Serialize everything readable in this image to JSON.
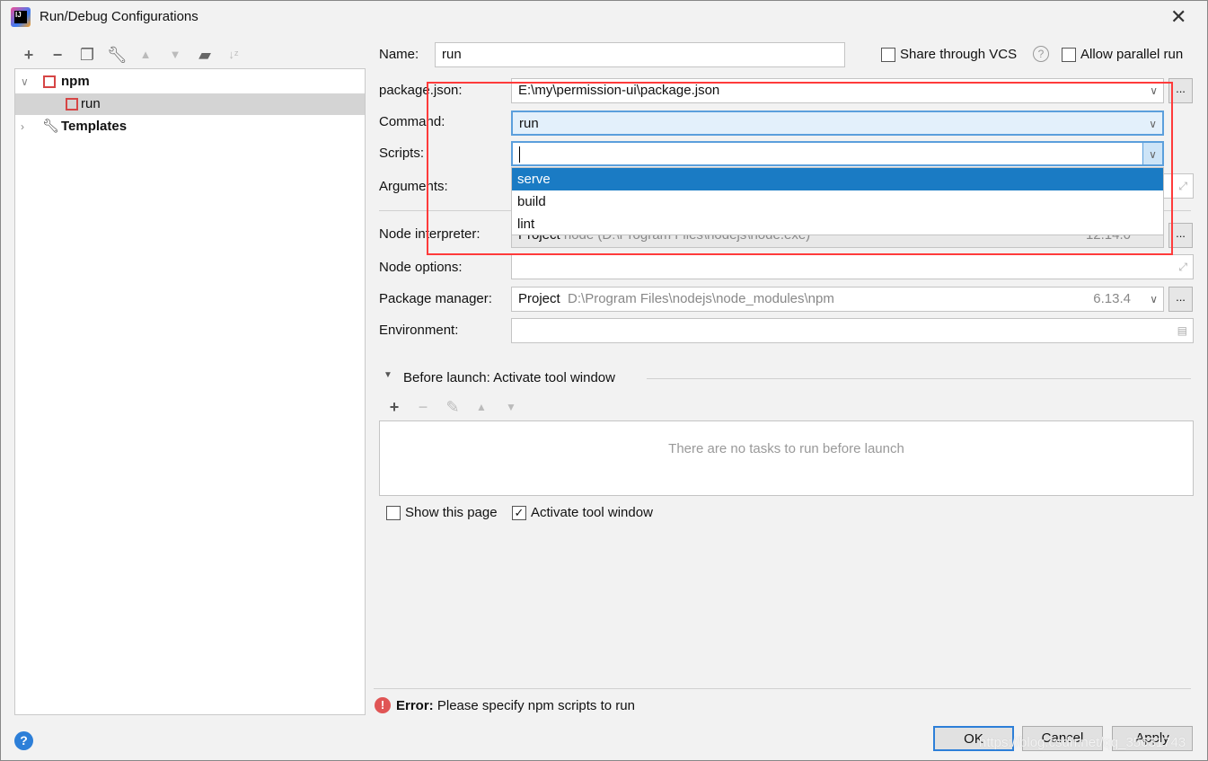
{
  "window": {
    "title": "Run/Debug Configurations"
  },
  "tree": {
    "npm": "npm",
    "run": "run",
    "templates": "Templates"
  },
  "form": {
    "name_label": "Name:",
    "name_value": "run",
    "share_vcs": "Share through VCS",
    "allow_parallel": "Allow parallel run",
    "package_json_label": "package.json:",
    "package_json_value": "E:\\my\\permission-ui\\package.json",
    "command_label": "Command:",
    "command_value": "run",
    "scripts_label": "Scripts:",
    "scripts_value": "",
    "scripts_options": [
      "serve",
      "build",
      "lint"
    ],
    "arguments_label": "Arguments:",
    "node_interpreter_label": "Node interpreter:",
    "node_interpreter_kind": "Project",
    "node_interpreter_path": "node (D:\\Program Files\\nodejs\\node.exe)",
    "node_interpreter_version": "12.14.0",
    "node_options_label": "Node options:",
    "package_manager_label": "Package manager:",
    "package_manager_kind": "Project",
    "package_manager_path": "D:\\Program Files\\nodejs\\node_modules\\npm",
    "package_manager_version": "6.13.4",
    "environment_label": "Environment:",
    "ellipsis": "..."
  },
  "before_launch": {
    "title": "Before launch: Activate tool window",
    "empty": "There are no tasks to run before launch"
  },
  "options": {
    "show_page": "Show this page",
    "show_page_checked": false,
    "activate_tool": "Activate tool window",
    "activate_tool_checked": true
  },
  "error": {
    "prefix": "Error:",
    "message": "Please specify npm scripts to run"
  },
  "buttons": {
    "ok": "OK",
    "cancel": "Cancel",
    "apply": "Apply"
  },
  "watermark": "https://blog.csdn.net/qq_35631743",
  "colors": {
    "selection": "#1a7bc4",
    "highlight_box": "#ff3b3b",
    "error": "#e05555"
  }
}
